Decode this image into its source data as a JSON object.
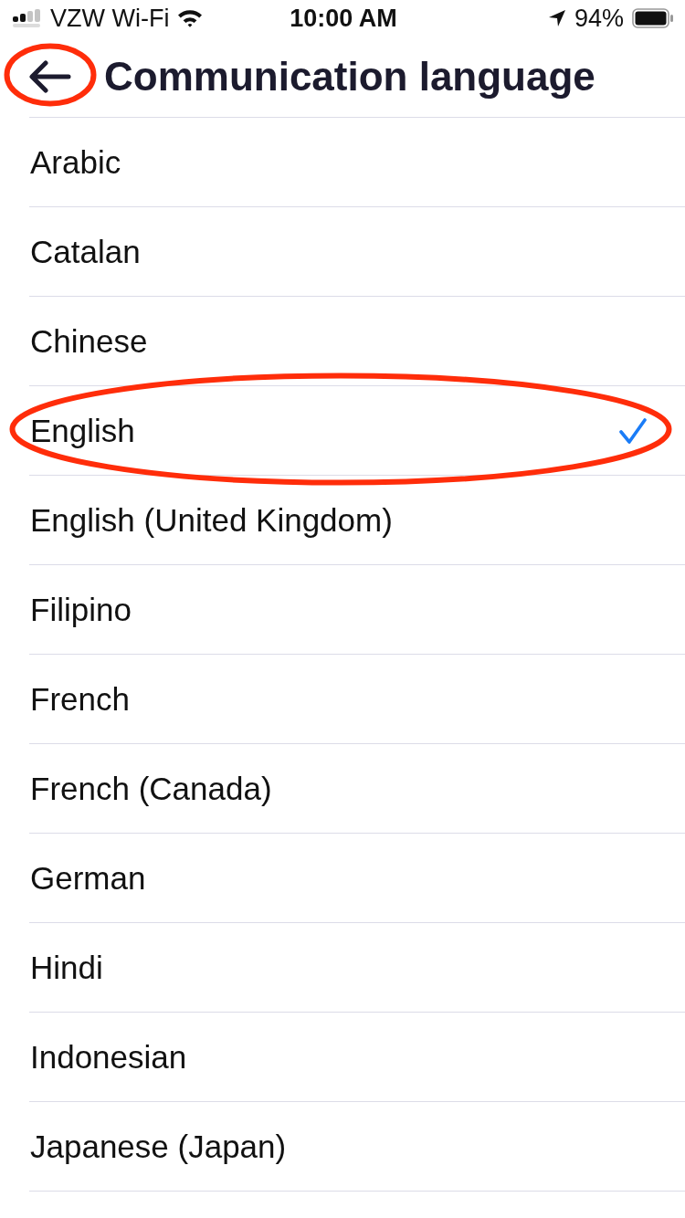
{
  "status_bar": {
    "carrier": "VZW Wi-Fi",
    "time": "10:00 AM",
    "battery": "94%"
  },
  "header": {
    "back_button": {
      "circled": true
    },
    "title": "Communication language"
  },
  "languages": [
    {
      "label": "Arabic",
      "selected": false,
      "circled": false
    },
    {
      "label": "Catalan",
      "selected": false,
      "circled": false
    },
    {
      "label": "Chinese",
      "selected": false,
      "circled": false
    },
    {
      "label": "English",
      "selected": true,
      "circled": true
    },
    {
      "label": "English (United Kingdom)",
      "selected": false,
      "circled": false
    },
    {
      "label": "Filipino",
      "selected": false,
      "circled": false
    },
    {
      "label": "French",
      "selected": false,
      "circled": false
    },
    {
      "label": "French (Canada)",
      "selected": false,
      "circled": false
    },
    {
      "label": "German",
      "selected": false,
      "circled": false
    },
    {
      "label": "Hindi",
      "selected": false,
      "circled": false
    },
    {
      "label": "Indonesian",
      "selected": false,
      "circled": false
    },
    {
      "label": "Japanese (Japan)",
      "selected": false,
      "circled": false
    }
  ]
}
